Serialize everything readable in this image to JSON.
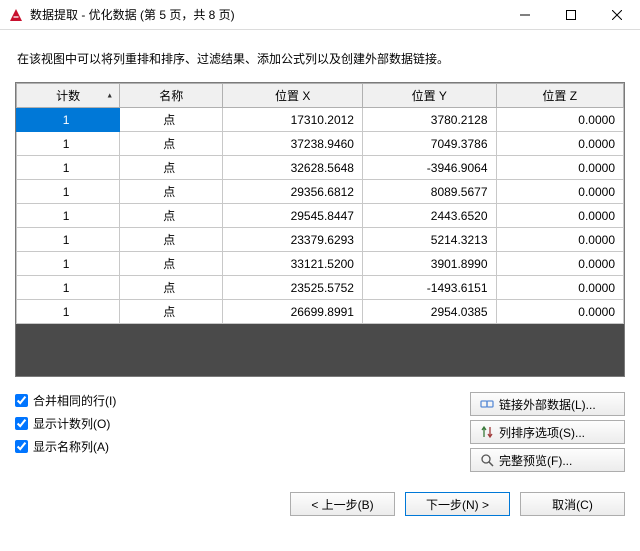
{
  "window": {
    "title": "数据提取 - 优化数据 (第 5 页，共 8 页)"
  },
  "description": "在该视图中可以将列重排和排序、过滤结果、添加公式列以及创建外部数据链接。",
  "columns": {
    "count": "计数",
    "name": "名称",
    "x": "位置 X",
    "y": "位置 Y",
    "z": "位置 Z"
  },
  "rows": [
    {
      "count": "1",
      "name": "点",
      "x": "17310.2012",
      "y": "3780.2128",
      "z": "0.0000",
      "selected": true
    },
    {
      "count": "1",
      "name": "点",
      "x": "37238.9460",
      "y": "7049.3786",
      "z": "0.0000"
    },
    {
      "count": "1",
      "name": "点",
      "x": "32628.5648",
      "y": "-3946.9064",
      "z": "0.0000"
    },
    {
      "count": "1",
      "name": "点",
      "x": "29356.6812",
      "y": "8089.5677",
      "z": "0.0000"
    },
    {
      "count": "1",
      "name": "点",
      "x": "29545.8447",
      "y": "2443.6520",
      "z": "0.0000"
    },
    {
      "count": "1",
      "name": "点",
      "x": "23379.6293",
      "y": "5214.3213",
      "z": "0.0000"
    },
    {
      "count": "1",
      "name": "点",
      "x": "33121.5200",
      "y": "3901.8990",
      "z": "0.0000"
    },
    {
      "count": "1",
      "name": "点",
      "x": "23525.5752",
      "y": "-1493.6151",
      "z": "0.0000"
    },
    {
      "count": "1",
      "name": "点",
      "x": "26699.8991",
      "y": "2954.0385",
      "z": "0.0000"
    }
  ],
  "checks": {
    "merge": "合并相同的行(I)",
    "show_count": "显示计数列(O)",
    "show_name": "显示名称列(A)"
  },
  "sideButtons": {
    "link": "链接外部数据(L)...",
    "sort": "列排序选项(S)...",
    "preview": "完整预览(F)..."
  },
  "nav": {
    "back": "< 上一步(B)",
    "next": "下一步(N) >",
    "cancel": "取消(C)"
  }
}
